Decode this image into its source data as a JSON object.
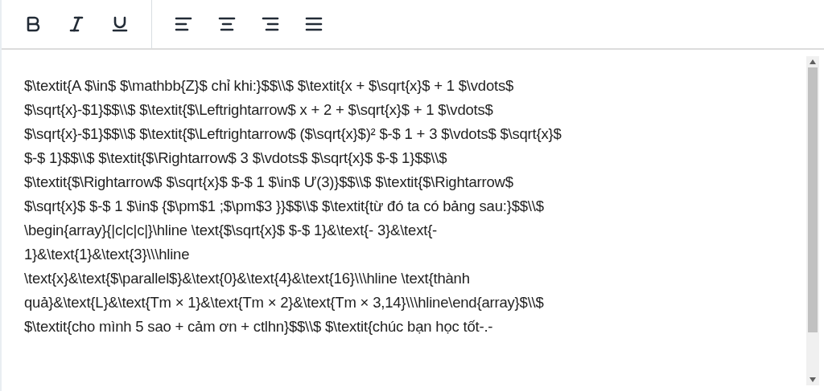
{
  "toolbar": {
    "groups": [
      [
        {
          "kind": "bold"
        },
        {
          "kind": "italic"
        },
        {
          "kind": "underline"
        }
      ],
      [
        {
          "kind": "align-left"
        },
        {
          "kind": "align-center"
        },
        {
          "kind": "align-right"
        },
        {
          "kind": "align-justify"
        }
      ]
    ]
  },
  "editor": {
    "lines": [
      "$\\textit{A $\\in$ $\\mathbb{Z}$ chỉ khi:}$$\\\\$ $\\textit{x + $\\sqrt{x}$ + 1 $\\vdots$",
      "$\\sqrt{x}-$1}$$\\\\$ $\\textit{$\\Leftrightarrow$ x + 2 + $\\sqrt{x}$ + 1 $\\vdots$",
      "$\\sqrt{x}-$1}$$\\\\$ $\\textit{$\\Leftrightarrow$ ($\\sqrt{x}$)² $-$ 1 + 3 $\\vdots$ $\\sqrt{x}$",
      "$-$ 1}$$\\\\$ $\\textit{$\\Rightarrow$ 3 $\\vdots$ $\\sqrt{x}$ $-$ 1}$$\\\\$",
      "$\\textit{$\\Rightarrow$ $\\sqrt{x}$ $-$ 1 $\\in$ Ư(3)}$$\\\\$ $\\textit{$\\Rightarrow$",
      "$\\sqrt{x}$ $-$ 1 $\\in$ {$\\pm$1 ;$\\pm$3 }}$$\\\\$ $\\textit{từ đó ta có bảng sau:}$$\\\\$",
      "\\begin{array}{|c|c|c|}\\hline \\text{$\\sqrt{x}$ $-$ 1}&\\text{- 3}&\\text{-",
      "1}&\\text{1}&\\text{3}\\\\\\hline",
      "\\text{x}&\\text{$\\parallel$}&\\text{0}&\\text{4}&\\text{16}\\\\\\hline \\text{thành",
      "quả}&\\text{L}&\\text{Tm × 1}&\\text{Tm × 2}&\\text{Tm × 3,14}\\\\\\hline\\end{array}$\\\\$",
      "$\\textit{cho mình 5 sao + cảm ơn + ctlhn}$$\\\\$ $\\textit{chúc bạn học tốt-.-"
    ]
  }
}
